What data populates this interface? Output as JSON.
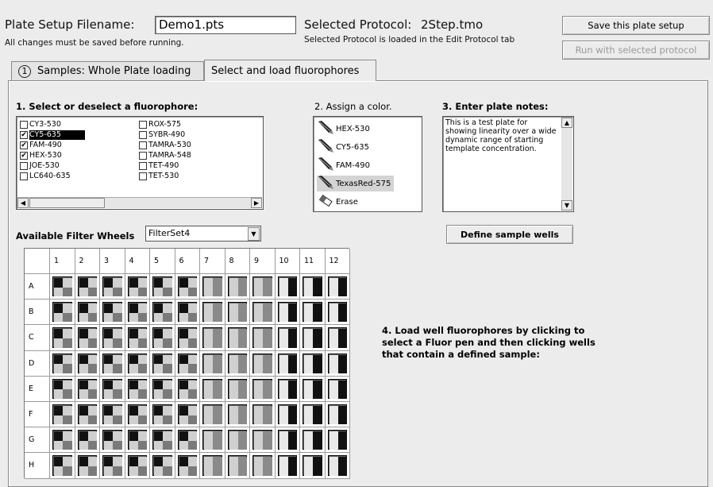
{
  "header": {
    "filename_label": "Plate Setup Filename:",
    "filename_value": "Demo1.pts",
    "save_note": "All changes must be saved before running.",
    "protocol_label": "Selected Protocol:",
    "protocol_value": "2Step.tmo",
    "protocol_note": "Selected Protocol is loaded in the Edit Protocol tab",
    "save_button": "Save this plate setup",
    "run_button": "Run with selected protocol"
  },
  "tabs": [
    {
      "number": "1",
      "label": "Samples: Whole Plate loading"
    },
    {
      "label": "Select and load fluorophores",
      "active": true
    }
  ],
  "fluorophore_section": {
    "title": "1.  Select or deselect a fluorophore:",
    "items": [
      {
        "label": "CY3-530",
        "checked": false
      },
      {
        "label": "CY5-635",
        "checked": true,
        "selected": true
      },
      {
        "label": "FAM-490",
        "checked": true
      },
      {
        "label": "HEX-530",
        "checked": true
      },
      {
        "label": "JOE-530",
        "checked": false
      },
      {
        "label": "LC640-635",
        "checked": false
      },
      {
        "label": "ROX-575",
        "checked": false
      },
      {
        "label": "SYBR-490",
        "checked": false
      },
      {
        "label": "TAMRA-530",
        "checked": false
      },
      {
        "label": "TAMRA-548",
        "checked": false
      },
      {
        "label": "TET-490",
        "checked": false
      },
      {
        "label": "TET-530",
        "checked": false
      }
    ]
  },
  "color_section": {
    "title": "2. Assign a color.",
    "items": [
      {
        "label": "HEX-530",
        "icon": "pen-icon"
      },
      {
        "label": "CY5-635",
        "icon": "pen-icon"
      },
      {
        "label": "FAM-490",
        "icon": "pen-icon"
      },
      {
        "label": "TexasRed-575",
        "icon": "pen-icon",
        "selected": true
      },
      {
        "label": "Erase",
        "icon": "eraser-icon"
      }
    ]
  },
  "notes_section": {
    "title": "3.  Enter plate notes:",
    "text": "This is a test plate for showing linearity over a wide dynamic range of starting template concentration.",
    "define_button": "Define sample wells"
  },
  "filter": {
    "label": "Available Filter Wheels",
    "value": "FilterSet4"
  },
  "instructions": "4. Load well fluorophores by clicking to select a Fluor pen and then clicking wells that contain a defined sample:",
  "plate": {
    "columns": [
      "1",
      "2",
      "3",
      "4",
      "5",
      "6",
      "7",
      "8",
      "9",
      "10",
      "11",
      "12"
    ],
    "rows": [
      "A",
      "B",
      "C",
      "D",
      "E",
      "F",
      "G",
      "H"
    ],
    "column_patterns": [
      "quad",
      "quad",
      "quad",
      "quad",
      "quad",
      "quad",
      "left-light",
      "left-light",
      "left-light",
      "right-dark",
      "right-dark",
      "right-dark"
    ]
  }
}
